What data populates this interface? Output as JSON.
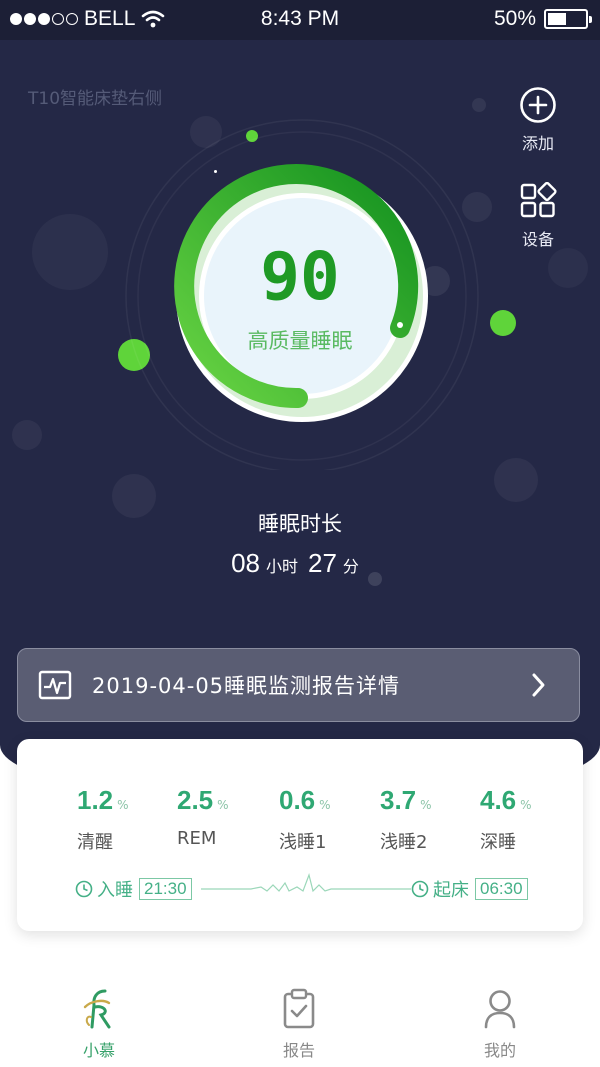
{
  "status_bar": {
    "carrier": "BELL",
    "time": "8:43 PM",
    "battery": "50%",
    "battery_level": 0.5
  },
  "device_name": "T10智能床垫右侧",
  "actions": {
    "add_label": "添加",
    "device_label": "设备"
  },
  "score": {
    "value": "90",
    "quality": "高质量睡眠"
  },
  "duration": {
    "title": "睡眠时长",
    "hours": "08",
    "hours_unit": "小时",
    "minutes": "27",
    "minutes_unit": "分"
  },
  "report": {
    "label": "2019-04-05睡眠监测报告详情"
  },
  "stats": [
    {
      "value": "1.2",
      "unit": "%",
      "label": "清醒"
    },
    {
      "value": "2.5",
      "unit": "%",
      "label": "REM"
    },
    {
      "value": "0.6",
      "unit": "%",
      "label": "浅睡1"
    },
    {
      "value": "3.7",
      "unit": "%",
      "label": "浅睡2"
    },
    {
      "value": "4.6",
      "unit": "%",
      "label": "深睡"
    }
  ],
  "timeline": {
    "sleep_label": "入睡",
    "sleep_time": "21:30",
    "wake_label": "起床",
    "wake_time": "06:30"
  },
  "tabs": [
    {
      "label": "小慕",
      "active": true,
      "icon": "brand-logo-icon"
    },
    {
      "label": "报告",
      "active": false,
      "icon": "clipboard-icon"
    },
    {
      "label": "我的",
      "active": false,
      "icon": "user-icon"
    }
  ],
  "colors": {
    "background": "#242846",
    "accent_green": "#1f9a25",
    "stat_green": "#2fa873"
  }
}
